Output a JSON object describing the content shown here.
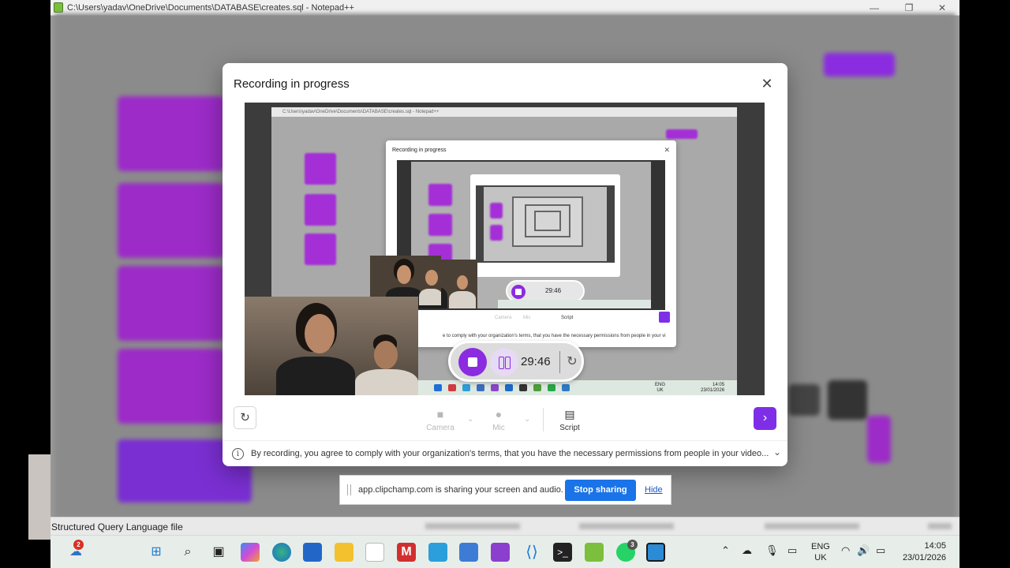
{
  "window": {
    "title": "C:\\Users\\yadav\\OneDrive\\Documents\\DATABASE\\creates.sql - Notepad++",
    "minimize": "—",
    "maximize": "❐",
    "close": "✕"
  },
  "statusbar": {
    "language": "Structured Query Language file"
  },
  "dialog": {
    "title": "Recording in progress",
    "close_icon": "✕",
    "timer": "29:46",
    "toolbar": {
      "camera_label": "Camera",
      "mic_label": "Mic",
      "script_label": "Script"
    },
    "consent": "By recording, you agree to comply with your organization's terms, that you have the necessary permissions from people in your video..."
  },
  "preview": {
    "nested_title": "Recording in progress",
    "nested_timer": "29:46",
    "nested_consent": "e to comply with your organization's terms, that you have the necessary permissions from people in your vi",
    "nested_camera": "Camera",
    "nested_mic": "Mic",
    "nested_script": "Script",
    "tray_lang": "ENG\nUK",
    "tray_time": "14:05\n23/01/2026"
  },
  "sharebar": {
    "message": "app.clipchamp.com is sharing your screen and audio.",
    "stop_label": "Stop sharing",
    "hide_label": "Hide"
  },
  "taskbar": {
    "notification_badge": "2",
    "whatsapp_badge": "3",
    "lang_line1": "ENG",
    "lang_line2": "UK",
    "time": "14:05",
    "date": "23/01/2026"
  },
  "colors": {
    "accent": "#7f2ee8",
    "record_stop": "#8b2ce0",
    "share_stop": "#1a73e8"
  }
}
